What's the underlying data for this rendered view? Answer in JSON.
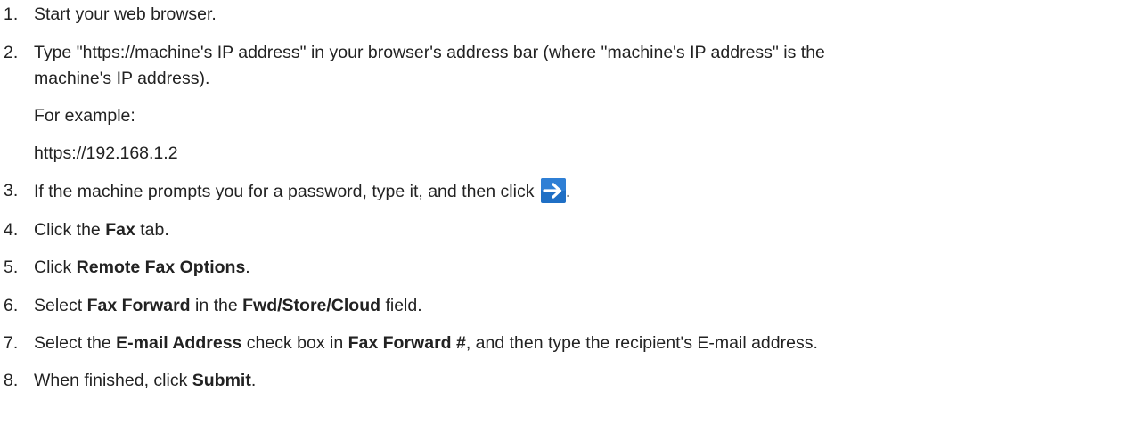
{
  "steps": [
    {
      "num": "1.",
      "text": "Start your web browser."
    },
    {
      "num": "2.",
      "line1": "Type \"https://machine's IP address\" in your browser's address bar (where \"machine's IP address\" is the",
      "line2": "machine's IP address).",
      "example_label": "For example:",
      "example_value": "https://192.168.1.2"
    },
    {
      "num": "3.",
      "text": "If the machine prompts you for a password, type it, and then click",
      "icon": "arrow-right-icon",
      "tail": "."
    },
    {
      "num": "4.",
      "pre": "Click the ",
      "bold": "Fax",
      "post": " tab."
    },
    {
      "num": "5.",
      "pre": "Click ",
      "bold": "Remote Fax Options",
      "post": "."
    },
    {
      "num": "6.",
      "pre": "Select ",
      "bold": "Fax Forward",
      "mid": " in the ",
      "bold2": "Fwd/Store/Cloud",
      "post": " field."
    },
    {
      "num": "7.",
      "pre": "Select the ",
      "bold": "E-mail Address",
      "mid": " check box in ",
      "bold2": "Fax Forward #",
      "post": ", and then type the recipient's E-mail address."
    },
    {
      "num": "8.",
      "pre": "When finished, click ",
      "bold": "Submit",
      "post": "."
    }
  ],
  "colors": {
    "text": "#222222",
    "icon_bg": "#1f6fc5",
    "icon_arrow": "#ffffff"
  }
}
